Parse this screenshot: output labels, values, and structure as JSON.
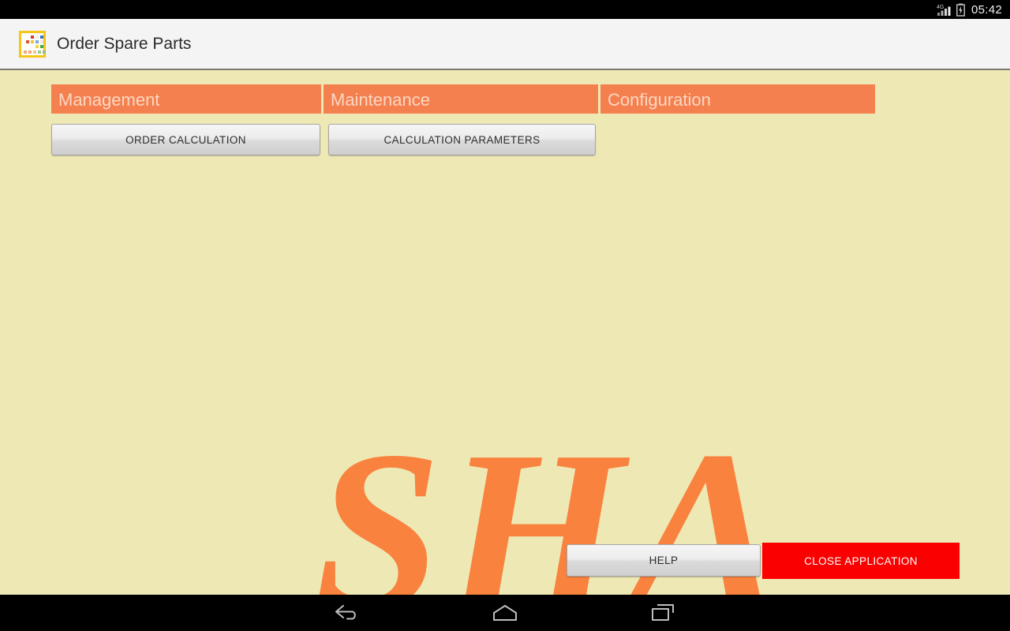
{
  "status_bar": {
    "network_label": "4G",
    "signal_icon": "signal-bars-icon",
    "battery_icon": "battery-charging-icon",
    "clock": "05:42"
  },
  "action_bar": {
    "icon": "app-logo-icon",
    "title": "Order Spare Parts"
  },
  "colors": {
    "background": "#EEE8B4",
    "tab_orange": "#F5804F",
    "tab_text": "#FBD7C3",
    "logo_orange": "#F9823F",
    "close_red": "#FA0000",
    "action_bar": "#F4F4F4",
    "icon_border": "#F5C518"
  },
  "tabs": [
    {
      "label": "Management"
    },
    {
      "label": "Maintenance"
    },
    {
      "label": "Configuration"
    }
  ],
  "buttons": [
    {
      "label": "ORDER CALCULATION"
    },
    {
      "label": "CALCULATION PARAMETERS"
    }
  ],
  "logo": {
    "text": "SHA"
  },
  "bottom_actions": {
    "help_label": "HELP",
    "close_label": "CLOSE APPLICATION"
  },
  "nav_bar": {
    "back": "back-arrow-icon",
    "home": "home-icon",
    "recents": "recent-apps-icon"
  }
}
